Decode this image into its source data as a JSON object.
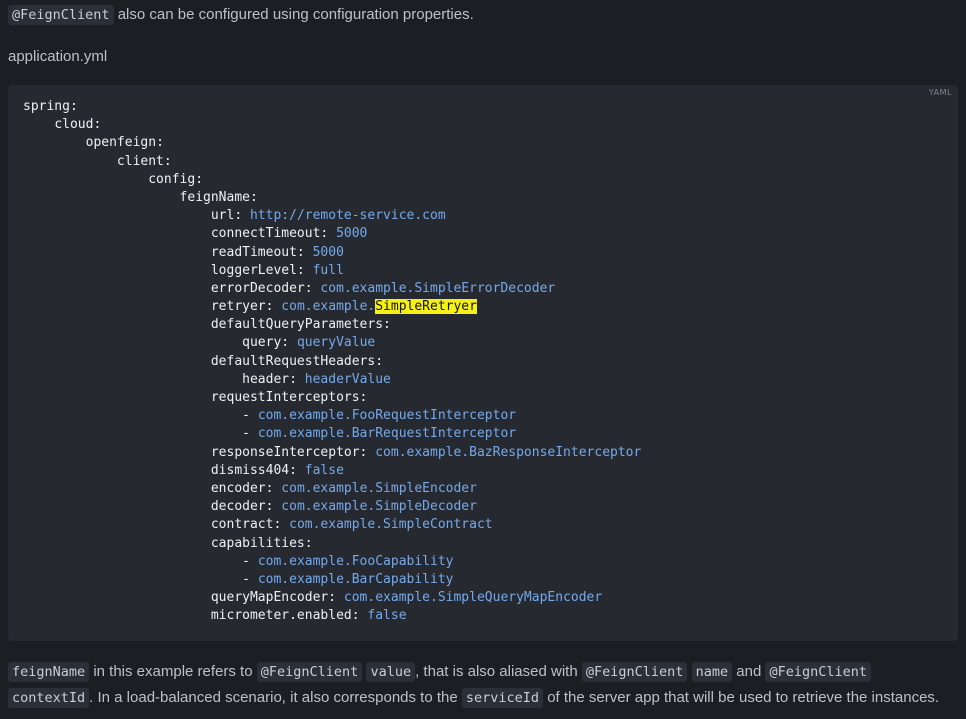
{
  "intro": {
    "code": "@FeignClient",
    "text": " also can be configured using configuration properties."
  },
  "filename": "application.yml",
  "codeblock": {
    "language_label": "YAML",
    "lines": [
      {
        "indent": "",
        "key": "spring:",
        "value": ""
      },
      {
        "indent": "    ",
        "key": "cloud:",
        "value": ""
      },
      {
        "indent": "        ",
        "key": "openfeign:",
        "value": ""
      },
      {
        "indent": "            ",
        "key": "client:",
        "value": ""
      },
      {
        "indent": "                ",
        "key": "config:",
        "value": ""
      },
      {
        "indent": "                    ",
        "key": "feignName:",
        "value": ""
      },
      {
        "indent": "                        ",
        "key": "url:",
        "value": "http://remote-service.com"
      },
      {
        "indent": "                        ",
        "key": "connectTimeout:",
        "value": "5000"
      },
      {
        "indent": "                        ",
        "key": "readTimeout:",
        "value": "5000"
      },
      {
        "indent": "                        ",
        "key": "loggerLevel:",
        "value": "full"
      },
      {
        "indent": "                        ",
        "key": "errorDecoder:",
        "value": "com.example.SimpleErrorDecoder"
      },
      {
        "indent": "                        ",
        "key": "retryer:",
        "value": "com.example.",
        "highlight": "SimpleRetryer"
      },
      {
        "indent": "                        ",
        "key": "defaultQueryParameters:",
        "value": ""
      },
      {
        "indent": "                            ",
        "key": "query:",
        "value": "queryValue"
      },
      {
        "indent": "                        ",
        "key": "defaultRequestHeaders:",
        "value": ""
      },
      {
        "indent": "                            ",
        "key": "header:",
        "value": "headerValue"
      },
      {
        "indent": "                        ",
        "key": "requestInterceptors:",
        "value": ""
      },
      {
        "indent": "                            ",
        "key": "-",
        "value": "com.example.FooRequestInterceptor"
      },
      {
        "indent": "                            ",
        "key": "-",
        "value": "com.example.BarRequestInterceptor"
      },
      {
        "indent": "                        ",
        "key": "responseInterceptor:",
        "value": "com.example.BazResponseInterceptor"
      },
      {
        "indent": "                        ",
        "key": "dismiss404:",
        "value": "false"
      },
      {
        "indent": "                        ",
        "key": "encoder:",
        "value": "com.example.SimpleEncoder"
      },
      {
        "indent": "                        ",
        "key": "decoder:",
        "value": "com.example.SimpleDecoder"
      },
      {
        "indent": "                        ",
        "key": "contract:",
        "value": "com.example.SimpleContract"
      },
      {
        "indent": "                        ",
        "key": "capabilities:",
        "value": ""
      },
      {
        "indent": "                            ",
        "key": "-",
        "value": "com.example.FooCapability"
      },
      {
        "indent": "                            ",
        "key": "-",
        "value": "com.example.BarCapability"
      },
      {
        "indent": "                        ",
        "key": "queryMapEncoder:",
        "value": "com.example.SimpleQueryMapEncoder"
      },
      {
        "indent": "                        ",
        "key": "micrometer.enabled:",
        "value": "false"
      }
    ]
  },
  "outro": {
    "code1": "feignName",
    "t1": " in this example refers to ",
    "code2": "@FeignClient",
    "t2": " ",
    "code3": "value",
    "t3": ", that is also aliased with ",
    "code4": "@FeignClient",
    "t4": " ",
    "code5": "name",
    "t5": " and ",
    "code6": "@FeignClient",
    "t6": " ",
    "code7": "contextId",
    "t7": ". In a load-balanced scenario, it also corresponds to the ",
    "code8": "serviceId",
    "t8": " of the server app that will be used to retrieve the instances."
  }
}
